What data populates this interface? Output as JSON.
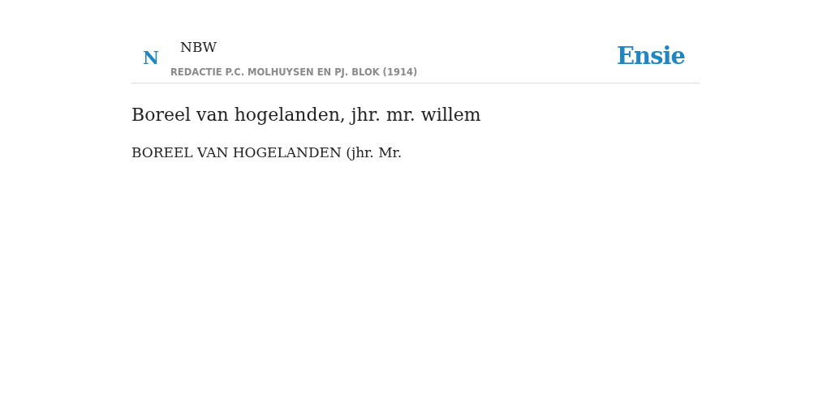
{
  "header": {
    "initial": "N",
    "source": "NBW",
    "subtitle": "REDACTIE P.C. MOLHUYSEN EN PJ. BLOK (1914)",
    "brand": "Ensie"
  },
  "article": {
    "title": "Boreel van hogelanden, jhr. mr. willem",
    "body": "BOREEL VAN HOGELANDEN (jhr. Mr."
  }
}
